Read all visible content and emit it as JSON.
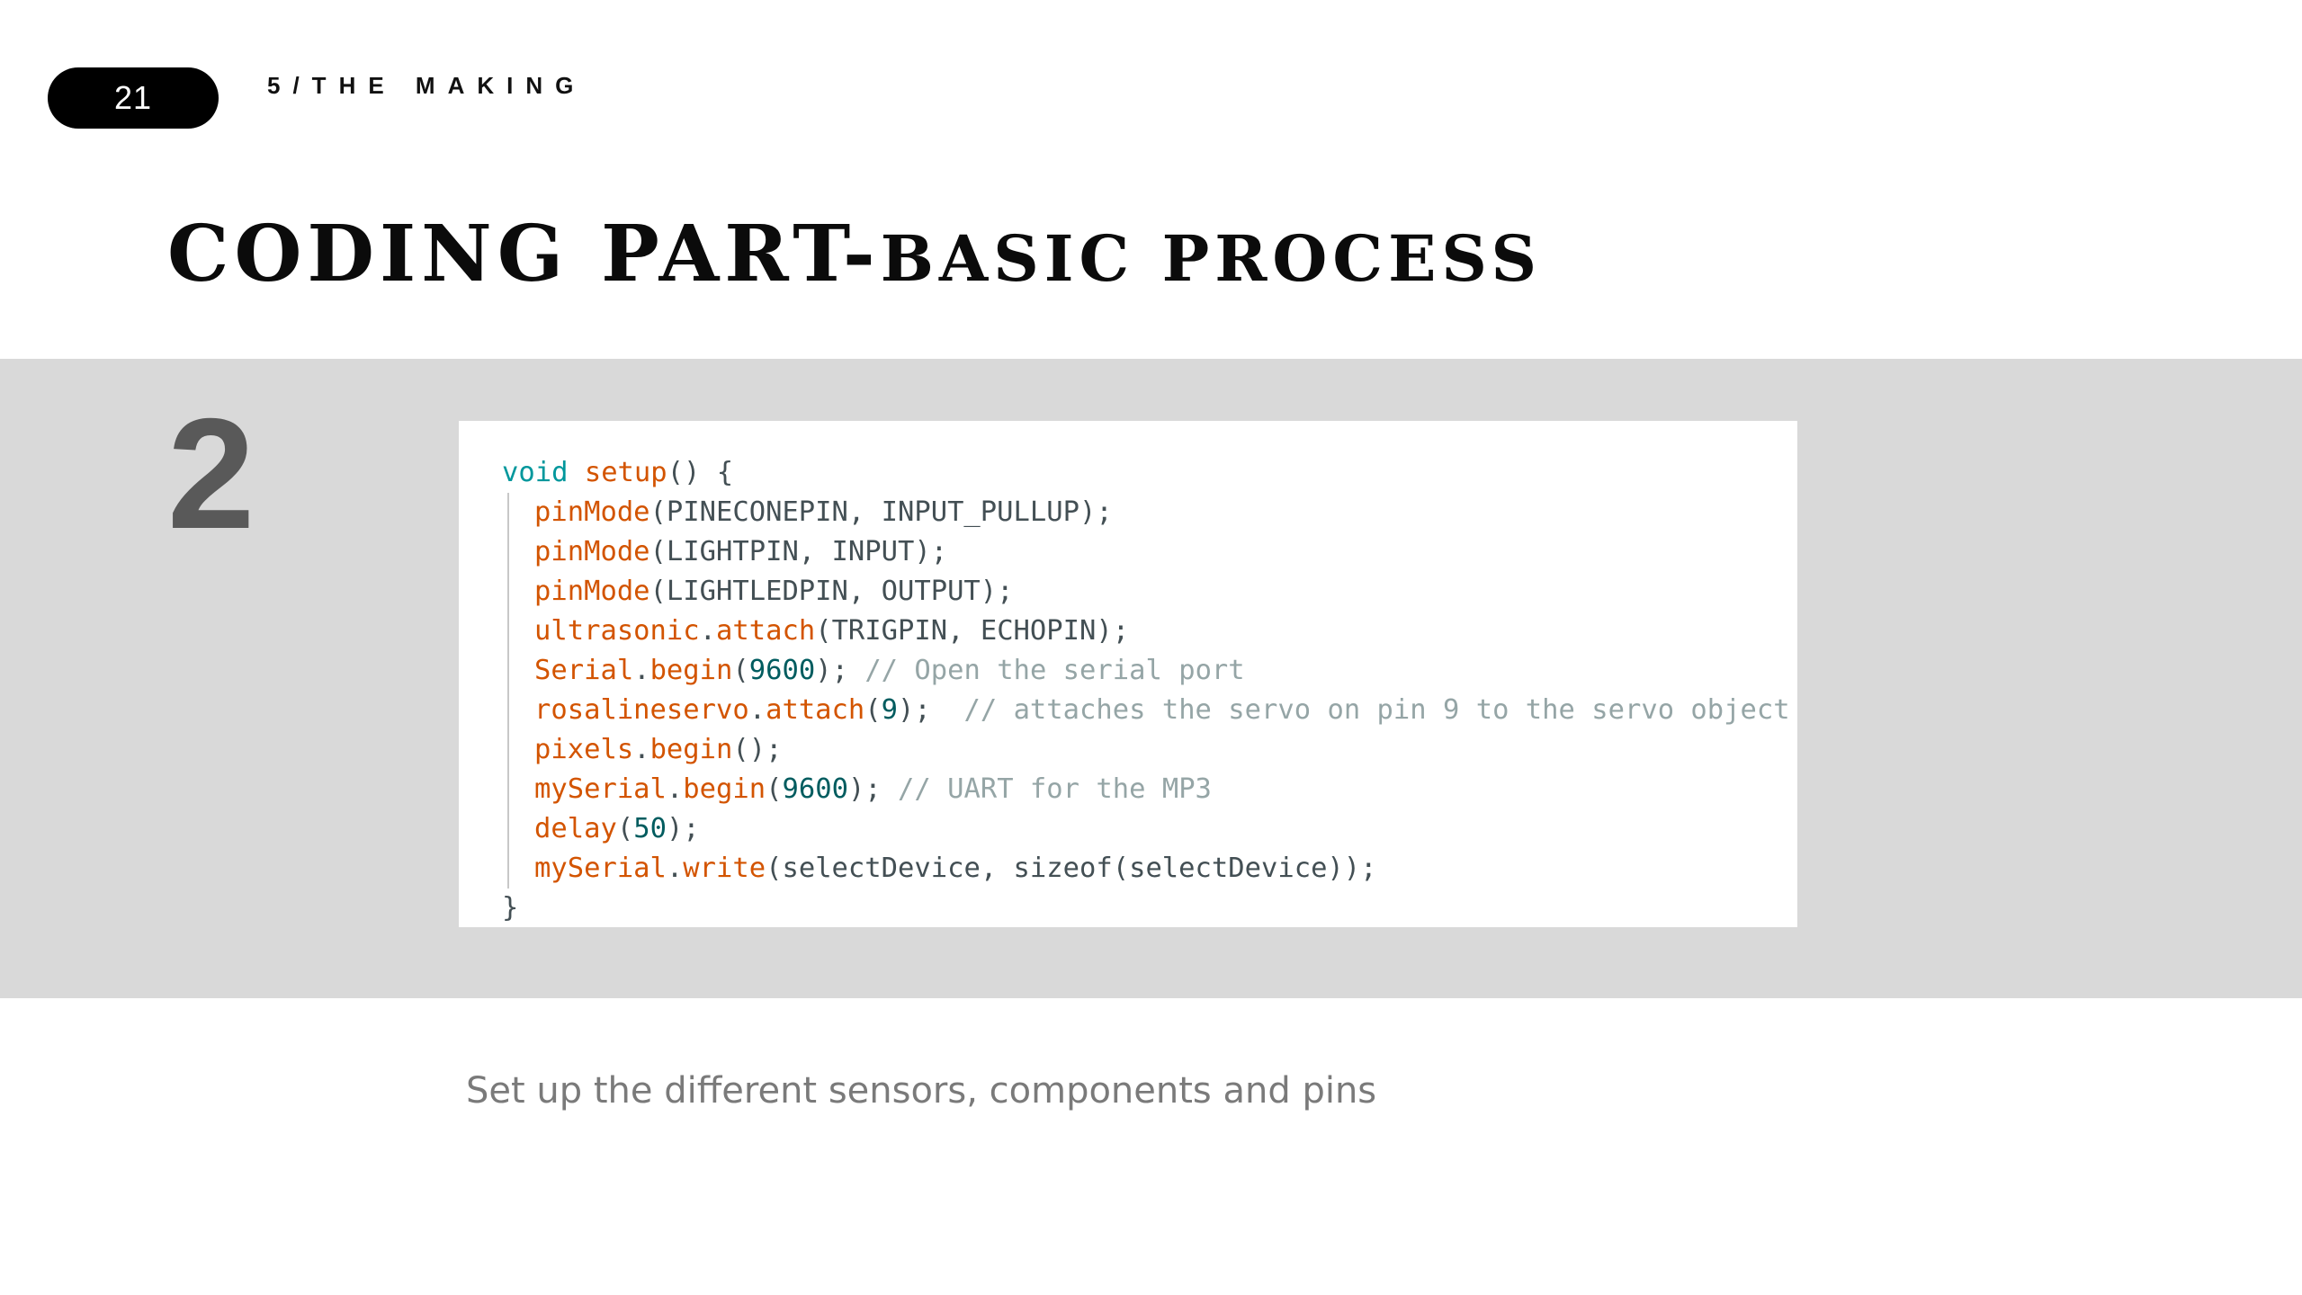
{
  "header": {
    "page_number": "21",
    "section_label": "5/THE MAKING"
  },
  "title": {
    "part1": "CODING PART-",
    "part2": "BASIC PROCESS"
  },
  "step": {
    "number": "2"
  },
  "code": {
    "lines": [
      [
        {
          "t": "void ",
          "c": "kw"
        },
        {
          "t": "setup",
          "c": "fn"
        },
        {
          "t": "() {",
          "c": "pl"
        }
      ],
      [
        {
          "t": "pinMode",
          "c": "fn"
        },
        {
          "t": "(PINECONEPIN, INPUT_PULLUP);",
          "c": "pl"
        }
      ],
      [
        {
          "t": "pinMode",
          "c": "fn"
        },
        {
          "t": "(LIGHTPIN, INPUT);",
          "c": "pl"
        }
      ],
      [
        {
          "t": "pinMode",
          "c": "fn"
        },
        {
          "t": "(LIGHTLEDPIN, OUTPUT);",
          "c": "pl"
        }
      ],
      [
        {
          "t": "ultrasonic",
          "c": "fn"
        },
        {
          "t": ".",
          "c": "pl"
        },
        {
          "t": "attach",
          "c": "fn"
        },
        {
          "t": "(TRIGPIN, ECHOPIN);",
          "c": "pl"
        }
      ],
      [
        {
          "t": "Serial",
          "c": "fn"
        },
        {
          "t": ".",
          "c": "pl"
        },
        {
          "t": "begin",
          "c": "fn"
        },
        {
          "t": "(",
          "c": "pl"
        },
        {
          "t": "9600",
          "c": "num"
        },
        {
          "t": "); ",
          "c": "pl"
        },
        {
          "t": "// Open the serial port",
          "c": "cm"
        }
      ],
      [
        {
          "t": "rosalineservo",
          "c": "fn"
        },
        {
          "t": ".",
          "c": "pl"
        },
        {
          "t": "attach",
          "c": "fn"
        },
        {
          "t": "(",
          "c": "pl"
        },
        {
          "t": "9",
          "c": "num"
        },
        {
          "t": ");  ",
          "c": "pl"
        },
        {
          "t": "// attaches the servo on pin 9 to the servo object",
          "c": "cm"
        }
      ],
      [
        {
          "t": "pixels",
          "c": "fn"
        },
        {
          "t": ".",
          "c": "pl"
        },
        {
          "t": "begin",
          "c": "fn"
        },
        {
          "t": "();",
          "c": "pl"
        }
      ],
      [
        {
          "t": "mySerial",
          "c": "fn"
        },
        {
          "t": ".",
          "c": "pl"
        },
        {
          "t": "begin",
          "c": "fn"
        },
        {
          "t": "(",
          "c": "pl"
        },
        {
          "t": "9600",
          "c": "num"
        },
        {
          "t": "); ",
          "c": "pl"
        },
        {
          "t": "// UART for the MP3",
          "c": "cm"
        }
      ],
      [
        {
          "t": "delay",
          "c": "fn"
        },
        {
          "t": "(",
          "c": "pl"
        },
        {
          "t": "50",
          "c": "num"
        },
        {
          "t": ");",
          "c": "pl"
        }
      ],
      [
        {
          "t": "mySerial",
          "c": "fn"
        },
        {
          "t": ".",
          "c": "pl"
        },
        {
          "t": "write",
          "c": "fn"
        },
        {
          "t": "(selectDevice, sizeof(selectDevice));",
          "c": "pl"
        }
      ],
      [
        {
          "t": "}",
          "c": "pl"
        }
      ]
    ]
  },
  "caption": "Set up the different sensors, components and pins",
  "colors": {
    "band": "#d9d9d9",
    "keyword": "#00979c",
    "function": "#d35400",
    "comment": "#95a5a6",
    "number": "#005c5f",
    "plain": "#434f54"
  }
}
